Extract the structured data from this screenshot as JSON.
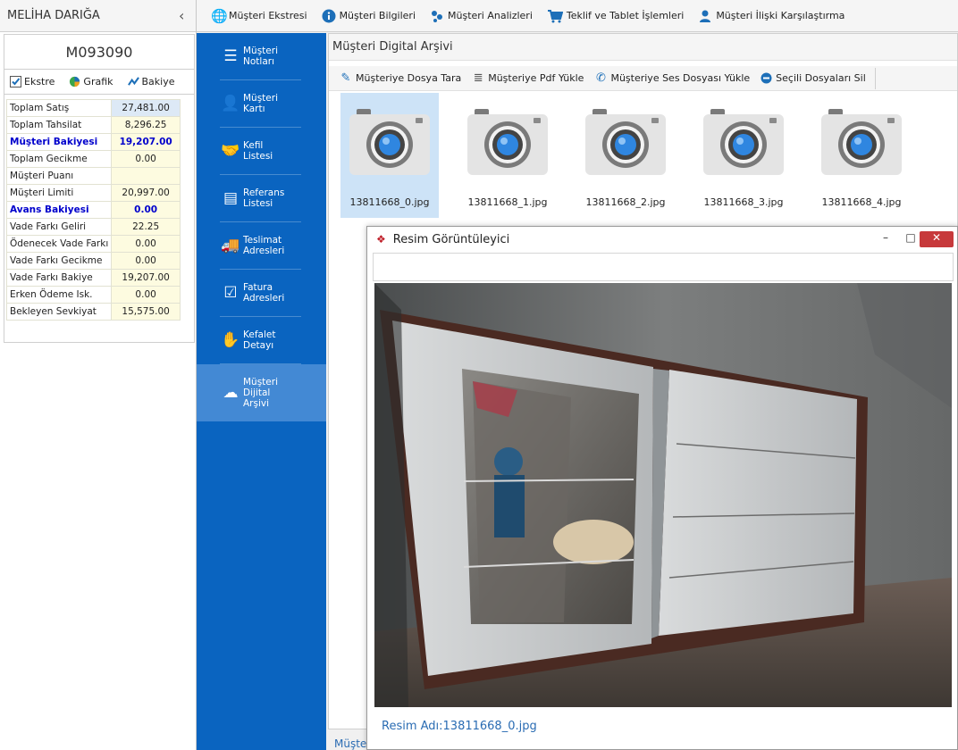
{
  "customer": {
    "name": "MELİHA DARIĞA",
    "code": "M093090"
  },
  "left_tabs": [
    {
      "label": "Ekstre",
      "icon": "checkbox-icon"
    },
    {
      "label": "Grafik",
      "icon": "pie-chart-icon"
    },
    {
      "label": "Bakiye",
      "icon": "line-chart-icon"
    }
  ],
  "summary": [
    {
      "label": "Toplam Satış",
      "value": "27,481.00"
    },
    {
      "label": "Toplam Tahsilat",
      "value": "8,296.25"
    },
    {
      "label": "Müşteri Bakiyesi",
      "value": "19,207.00",
      "bold": true
    },
    {
      "label": "Toplam Gecikme",
      "value": "0.00"
    },
    {
      "label": "Müşteri Puanı",
      "value": ""
    },
    {
      "label": "Müşteri Limiti",
      "value": "20,997.00"
    },
    {
      "label": "Avans Bakiyesi",
      "value": "0.00",
      "bold": true
    },
    {
      "label": "Vade Farkı Geliri",
      "value": "22.25"
    },
    {
      "label": "Ödenecek Vade Farkı",
      "value": "0.00"
    },
    {
      "label": "Vade Farkı Gecikme",
      "value": "0.00"
    },
    {
      "label": "Vade Farkı Bakiye",
      "value": "19,207.00"
    },
    {
      "label": "Erken Ödeme Isk.",
      "value": "0.00"
    },
    {
      "label": "Bekleyen Sevkiyat",
      "value": "15,575.00"
    }
  ],
  "top_menu": [
    {
      "label": "Müşteri Ekstresi",
      "icon": "globe-icon"
    },
    {
      "label": "Müşteri Bilgileri",
      "icon": "info-icon"
    },
    {
      "label": "Müşteri Analizleri",
      "icon": "analysis-icon"
    },
    {
      "label": "Teklif ve Tablet İşlemleri",
      "icon": "cart-icon"
    },
    {
      "label": "Müşteri İlişki Karşılaştırma",
      "icon": "person-compare-icon"
    }
  ],
  "nav": [
    {
      "label": "Müşteri\nNotları",
      "icon": "notes-icon"
    },
    {
      "label": "Müşteri\nKartı",
      "icon": "id-card-icon"
    },
    {
      "label": "Kefil\nListesi",
      "icon": "handshake-icon"
    },
    {
      "label": "Referans\nListesi",
      "icon": "reference-icon"
    },
    {
      "label": "Teslimat\nAdresleri",
      "icon": "truck-icon"
    },
    {
      "label": "Fatura\nAdresleri",
      "icon": "invoice-icon"
    },
    {
      "label": "Kefalet\nDetayı",
      "icon": "guarantee-icon"
    },
    {
      "label": "Müşteri\nDijital\nArşivi",
      "icon": "cloud-download-icon",
      "active": true
    }
  ],
  "archive": {
    "title": "Müşteri Digital Arşivi",
    "toolbar": [
      {
        "label": "Müşteriye Dosya Tara",
        "icon": "scan-icon"
      },
      {
        "label": "Müşteriye Pdf Yükle",
        "icon": "pdf-icon"
      },
      {
        "label": "Müşteriye Ses Dosyası Yükle",
        "icon": "phone-icon"
      },
      {
        "label": "Seçili Dosyaları Sil",
        "icon": "delete-icon"
      }
    ],
    "files": [
      "13811668_0.jpg",
      "13811668_1.jpg",
      "13811668_2.jpg",
      "13811668_3.jpg",
      "13811668_4.jpg"
    ],
    "bottom_tab": "Müşteri Digital Arşivi"
  },
  "viewer": {
    "title": "Resim Görüntüleyici",
    "caption": "Resim Adı:13811668_0.jpg",
    "min_symbol": "–",
    "max_symbol": "□",
    "close_symbol": "✕"
  }
}
